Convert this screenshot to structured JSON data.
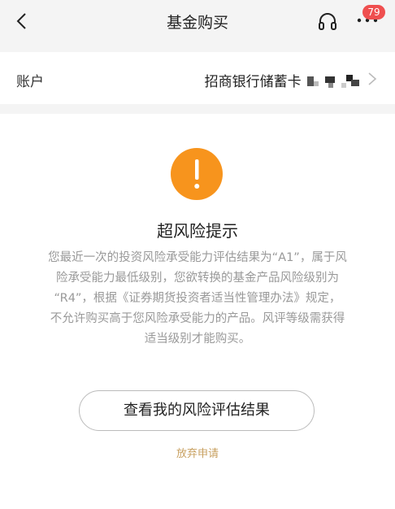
{
  "nav": {
    "title": "基金购买",
    "badge": "79"
  },
  "account": {
    "label": "账户",
    "value": "招商银行储蓄卡"
  },
  "alert": {
    "title": "超风险提示",
    "lines": [
      "您最近一次的投资风险承受能力评估结果为“A1”，属于风",
      "险承受能力最低级别，您欲转换的基金产品风险级别为",
      "“R4”，根据《证券期货投资者适当性管理办法》规定，",
      "不允许购买高于您风险承受能力的产品。风评等级需获得",
      "适当级别才能购买。"
    ]
  },
  "actions": {
    "view_result": "查看我的风险评估结果",
    "abandon": "放弃申请"
  },
  "colors": {
    "warning": "#f7941d",
    "badge": "#ef4f4f",
    "link": "#c8a060"
  }
}
